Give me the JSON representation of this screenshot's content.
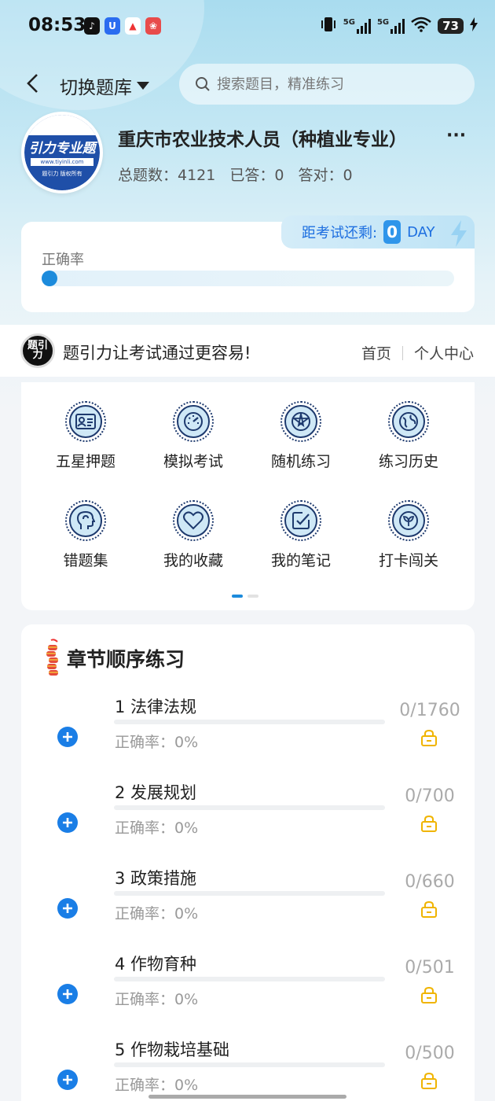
{
  "status_bar": {
    "time": "08:53",
    "battery": "73",
    "net1": "5G",
    "net2": "5G"
  },
  "header": {
    "switch_label": "切换题库",
    "search_placeholder": "搜索题目，精准练习"
  },
  "exam": {
    "logo_text": "引力专业题",
    "logo_url": "www.tiyinli.com",
    "logo_copyright": "题引力 版权所有",
    "title": "重庆市农业技术人员（种植业专业）",
    "more": "···",
    "total_label": "总题数：4121",
    "answered_label": "已答：0",
    "correct_label": "答对：0"
  },
  "accuracy": {
    "label": "正确率",
    "value": 0,
    "countdown_prefix": "距考试还剩:",
    "countdown_days": "0",
    "countdown_unit": "DAY"
  },
  "slogan": {
    "logo": "题引力",
    "text": "题引力让考试通过更容易!",
    "nav_home": "首页",
    "nav_personal": "个人中心"
  },
  "menu": {
    "items": [
      {
        "label": "五星押题",
        "icon": "id-card-icon"
      },
      {
        "label": "模拟考试",
        "icon": "speedometer-icon"
      },
      {
        "label": "随机练习",
        "icon": "star-compass-icon"
      },
      {
        "label": "练习历史",
        "icon": "globe-icon"
      },
      {
        "label": "错题集",
        "icon": "head-icon"
      },
      {
        "label": "我的收藏",
        "icon": "heart-icon"
      },
      {
        "label": "我的笔记",
        "icon": "note-check-icon"
      },
      {
        "label": "打卡闯关",
        "icon": "leaf-icon"
      }
    ],
    "page": 1,
    "pages": 2
  },
  "chapters": {
    "title": "章节顺序练习",
    "items": [
      {
        "name": "1 法律法规",
        "accuracy": "正确率：0%",
        "count": "0/1760"
      },
      {
        "name": "2 发展规划",
        "accuracy": "正确率：0%",
        "count": "0/700"
      },
      {
        "name": "3 政策措施",
        "accuracy": "正确率：0%",
        "count": "0/660"
      },
      {
        "name": "4 作物育种",
        "accuracy": "正确率：0%",
        "count": "0/501"
      },
      {
        "name": "5 作物栽培基础",
        "accuracy": "正确率：0%",
        "count": "0/500"
      }
    ]
  },
  "colors": {
    "accent": "#1a7ee6",
    "lock": "#f0b400",
    "navy": "#1e3a6e"
  }
}
